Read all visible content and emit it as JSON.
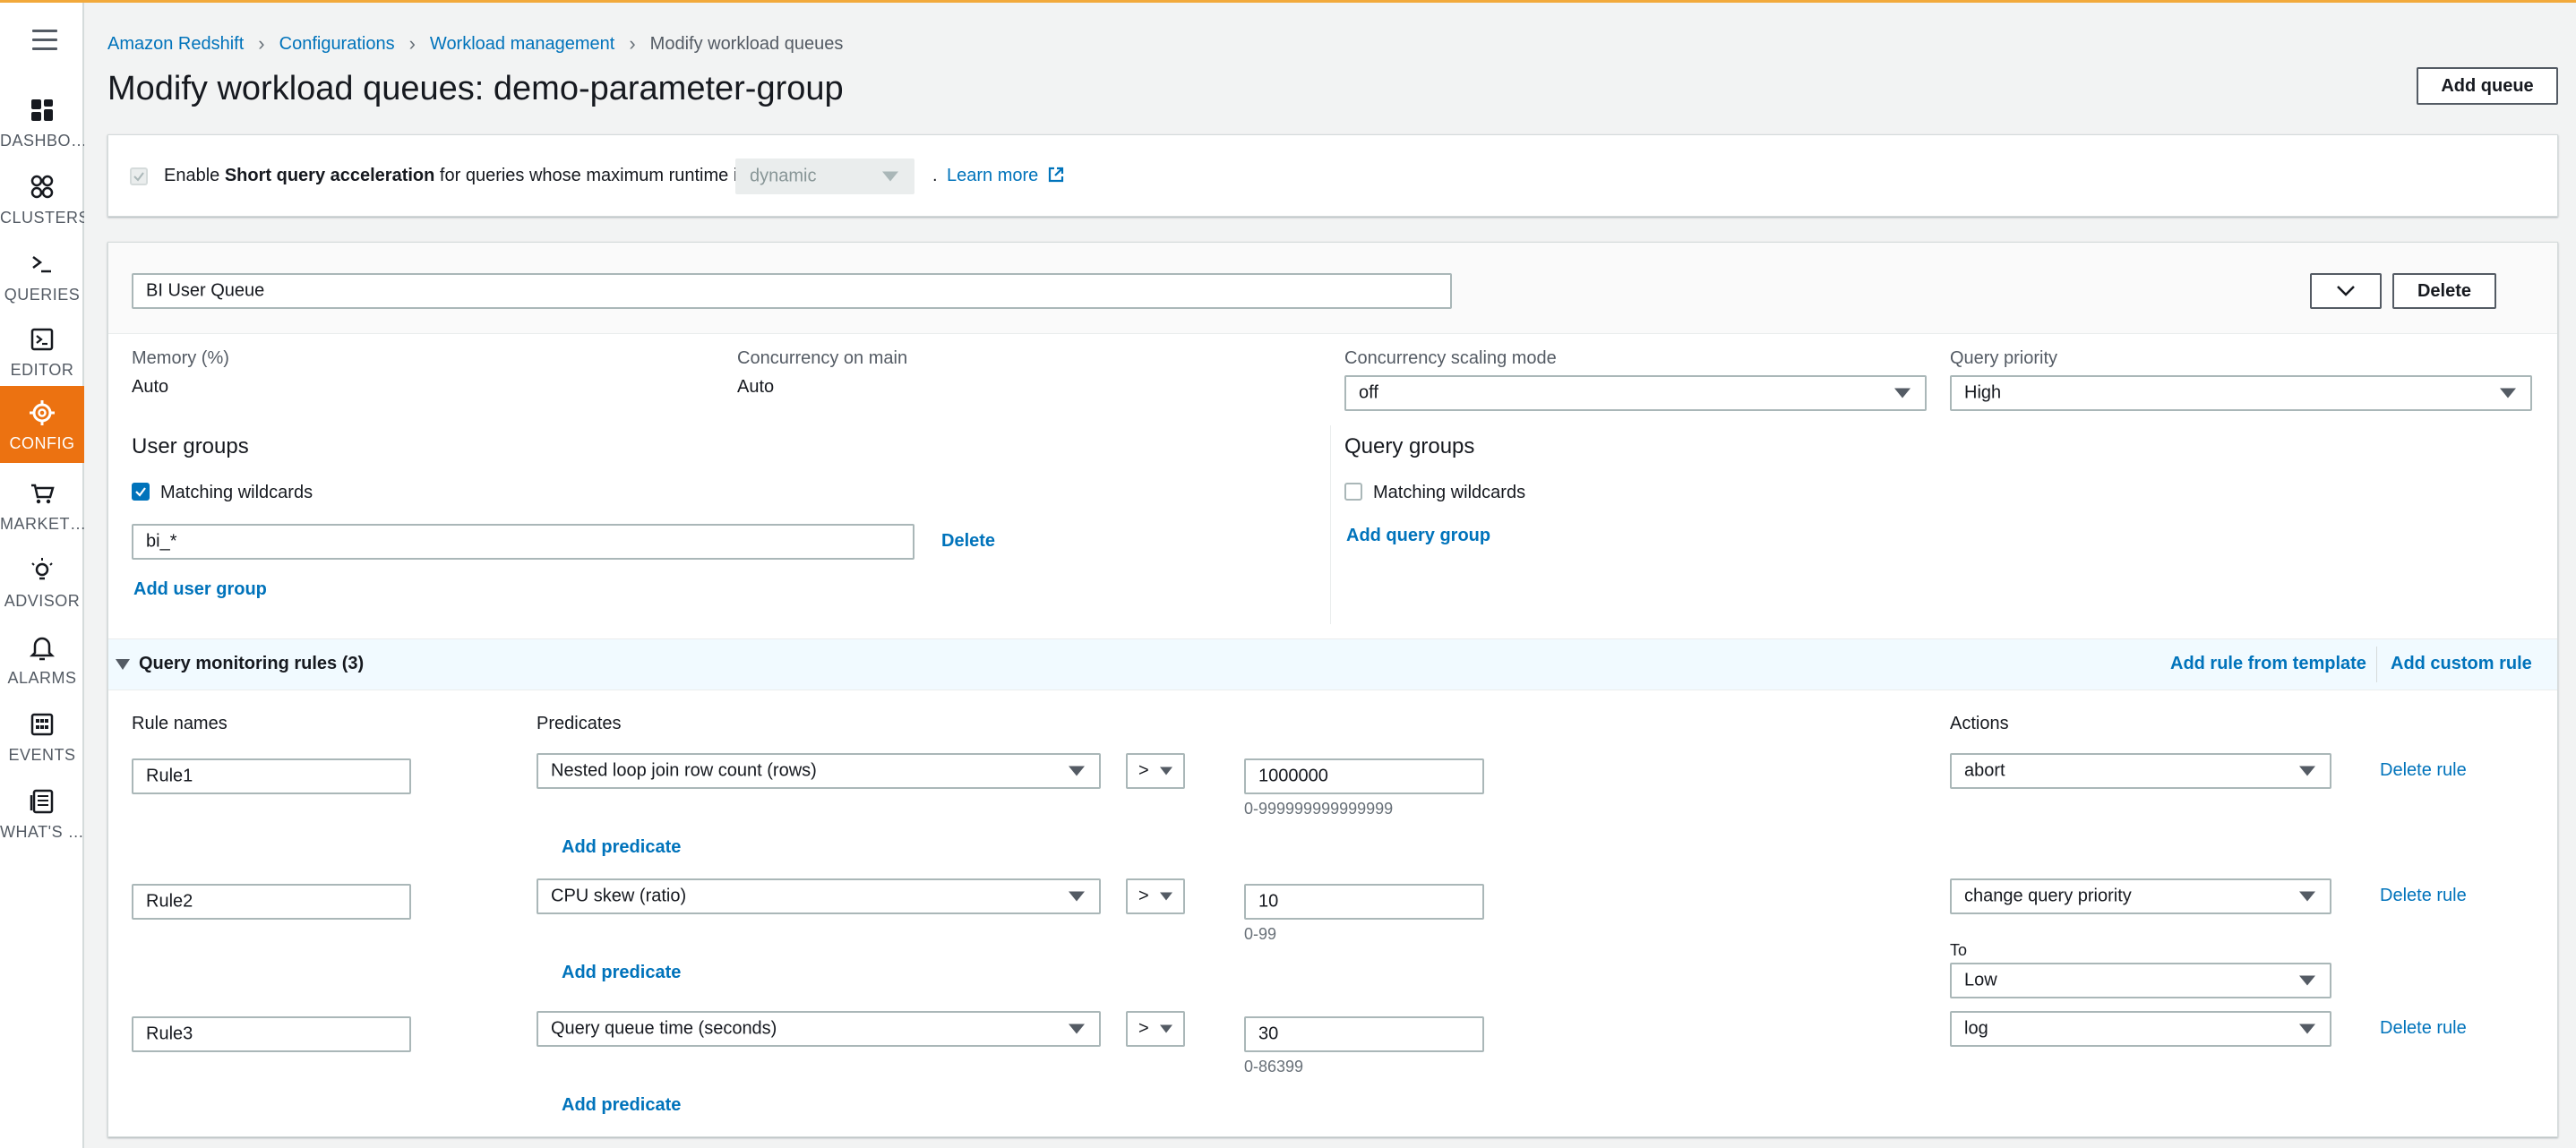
{
  "sidebar": {
    "items": [
      {
        "label": "DASHBO…",
        "icon": "dashboard-icon"
      },
      {
        "label": "CLUSTERS",
        "icon": "clusters-icon"
      },
      {
        "label": "QUERIES",
        "icon": "queries-icon"
      },
      {
        "label": "EDITOR",
        "icon": "editor-icon"
      },
      {
        "label": "CONFIG",
        "icon": "config-icon",
        "active": true
      },
      {
        "label": "MARKET…",
        "icon": "marketplace-icon"
      },
      {
        "label": "ADVISOR",
        "icon": "advisor-icon"
      },
      {
        "label": "ALARMS",
        "icon": "alarms-icon"
      },
      {
        "label": "EVENTS",
        "icon": "events-icon"
      },
      {
        "label": "WHAT'S …",
        "icon": "whats-new-icon"
      }
    ]
  },
  "breadcrumb": {
    "items": [
      "Amazon Redshift",
      "Configurations",
      "Workload management"
    ],
    "current": "Modify workload queues"
  },
  "page": {
    "title": "Modify workload queues: demo-parameter-group",
    "add_queue_label": "Add queue"
  },
  "sqa": {
    "text_before": "Enable ",
    "text_bold": "Short query acceleration",
    "text_after": " for queries whose maximum runtime is",
    "select_value": "dynamic",
    "dot": ".",
    "learn_more": "Learn more"
  },
  "queue": {
    "name": "BI User Queue",
    "delete_label": "Delete",
    "memory_label": "Memory (%)",
    "memory_value": "Auto",
    "concurrency_label": "Concurrency on main",
    "concurrency_value": "Auto",
    "scaling_label": "Concurrency scaling mode",
    "scaling_value": "off",
    "priority_label": "Query priority",
    "priority_value": "High",
    "user_groups_title": "User groups",
    "user_wildcards_label": "Matching wildcards",
    "user_group_value": "bi_*",
    "user_group_delete": "Delete",
    "add_user_group": "Add user group",
    "query_groups_title": "Query groups",
    "query_wildcards_label": "Matching wildcards",
    "add_query_group": "Add query group"
  },
  "qmr": {
    "title": "Query monitoring rules (3)",
    "add_from_template": "Add rule from template",
    "add_custom": "Add custom rule",
    "col_rule_names": "Rule names",
    "col_predicates": "Predicates",
    "col_actions": "Actions",
    "add_predicate": "Add predicate",
    "delete_rule": "Delete rule",
    "to_label": "To",
    "rules": [
      {
        "name": "Rule1",
        "predicate": "Nested loop join row count (rows)",
        "operator": ">",
        "value": "1000000",
        "range": "0-999999999999999",
        "action": "abort"
      },
      {
        "name": "Rule2",
        "predicate": "CPU skew (ratio)",
        "operator": ">",
        "value": "10",
        "range": "0-99",
        "action": "change query priority",
        "to": "Low"
      },
      {
        "name": "Rule3",
        "predicate": "Query queue time (seconds)",
        "operator": ">",
        "value": "30",
        "range": "0-86399",
        "action": "log"
      }
    ]
  }
}
